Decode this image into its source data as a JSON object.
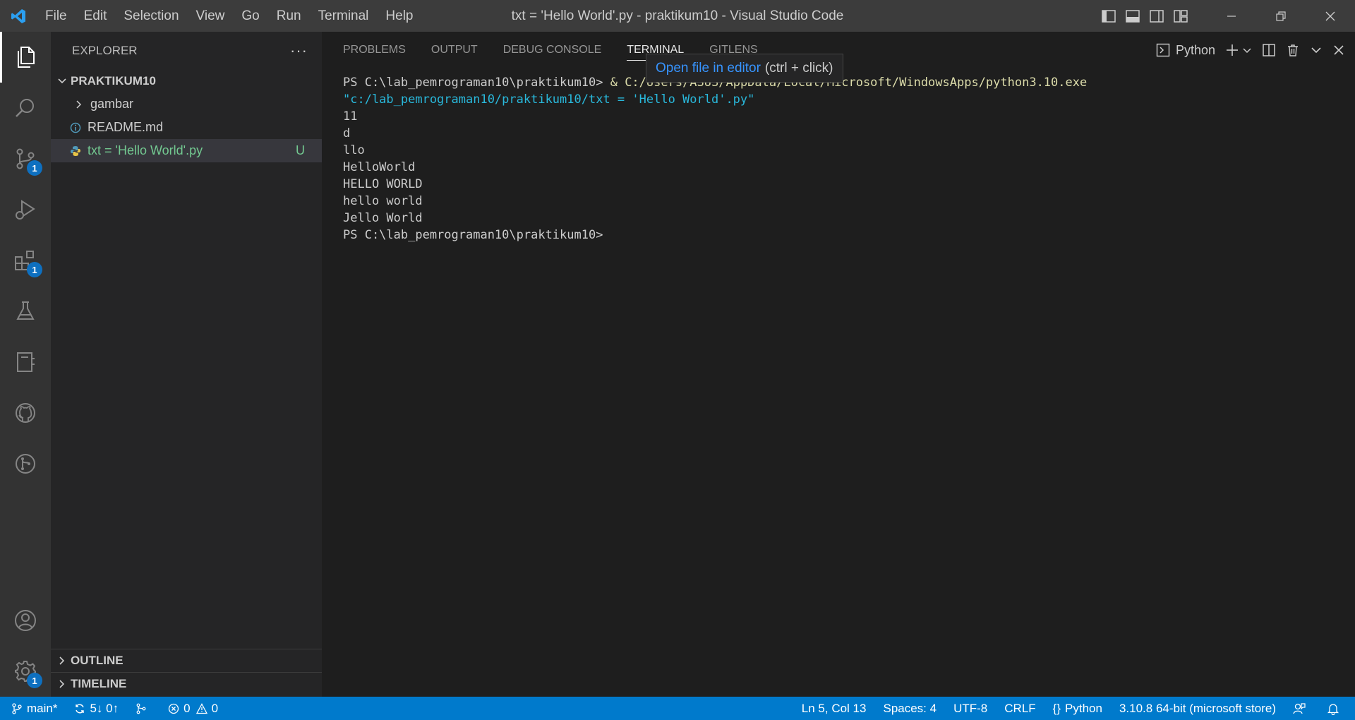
{
  "colors": {
    "titlebar": "#3c3c3c",
    "activitybar": "#333333",
    "sidebar": "#252526",
    "panel": "#1e1e1e",
    "statusbar": "#007acc",
    "badge": "#0e70c0",
    "untracked": "#73c991"
  },
  "titlebar": {
    "menu": [
      "File",
      "Edit",
      "Selection",
      "View",
      "Go",
      "Run",
      "Terminal",
      "Help"
    ],
    "title": "txt = 'Hello World'.py - praktikum10 - Visual Studio Code"
  },
  "activitybar": {
    "badges": {
      "source_control": "1",
      "extensions": "1",
      "manage": "1"
    }
  },
  "sidebar": {
    "header": "EXPLORER",
    "more": "···",
    "folder": "PRAKTIKUM10",
    "items": [
      {
        "label": "gambar",
        "type": "folder"
      },
      {
        "label": "README.md",
        "type": "info-file"
      },
      {
        "label": "txt = 'Hello World'.py",
        "type": "python-file",
        "status": "U"
      }
    ],
    "outline": "OUTLINE",
    "timeline": "TIMELINE"
  },
  "panel": {
    "tabs": [
      "PROBLEMS",
      "OUTPUT",
      "DEBUG CONSOLE",
      "TERMINAL",
      "GITLENS"
    ],
    "active_tab": "TERMINAL",
    "shell": "Python",
    "tooltip": {
      "link": "Open file in editor",
      "hint": "(ctrl + click)"
    },
    "terminal": {
      "prompt": "PS C:\\lab_pemrograman10\\praktikum10> ",
      "amp": "& ",
      "exe": "C:/Users/ASUS/AppData/Local/Microsoft/WindowsApps/python3.10.exe",
      "arg": "\"c:/lab_pemrograman10/praktikum10/txt = 'Hello World'.py\"",
      "output": [
        "11",
        "d",
        "llo",
        "HelloWorld",
        "HELLO WORLD",
        "hello world",
        "Jello World"
      ],
      "final_prompt": "PS C:\\lab_pemrograman10\\praktikum10>"
    }
  },
  "statusbar": {
    "branch": "main*",
    "sync": "5↓ 0↑",
    "errors": "0",
    "warnings": "0",
    "position": "Ln 5, Col 13",
    "spaces": "Spaces: 4",
    "encoding": "UTF-8",
    "eol": "CRLF",
    "language": "Python",
    "interpreter": "3.10.8 64-bit (microsoft store)"
  }
}
